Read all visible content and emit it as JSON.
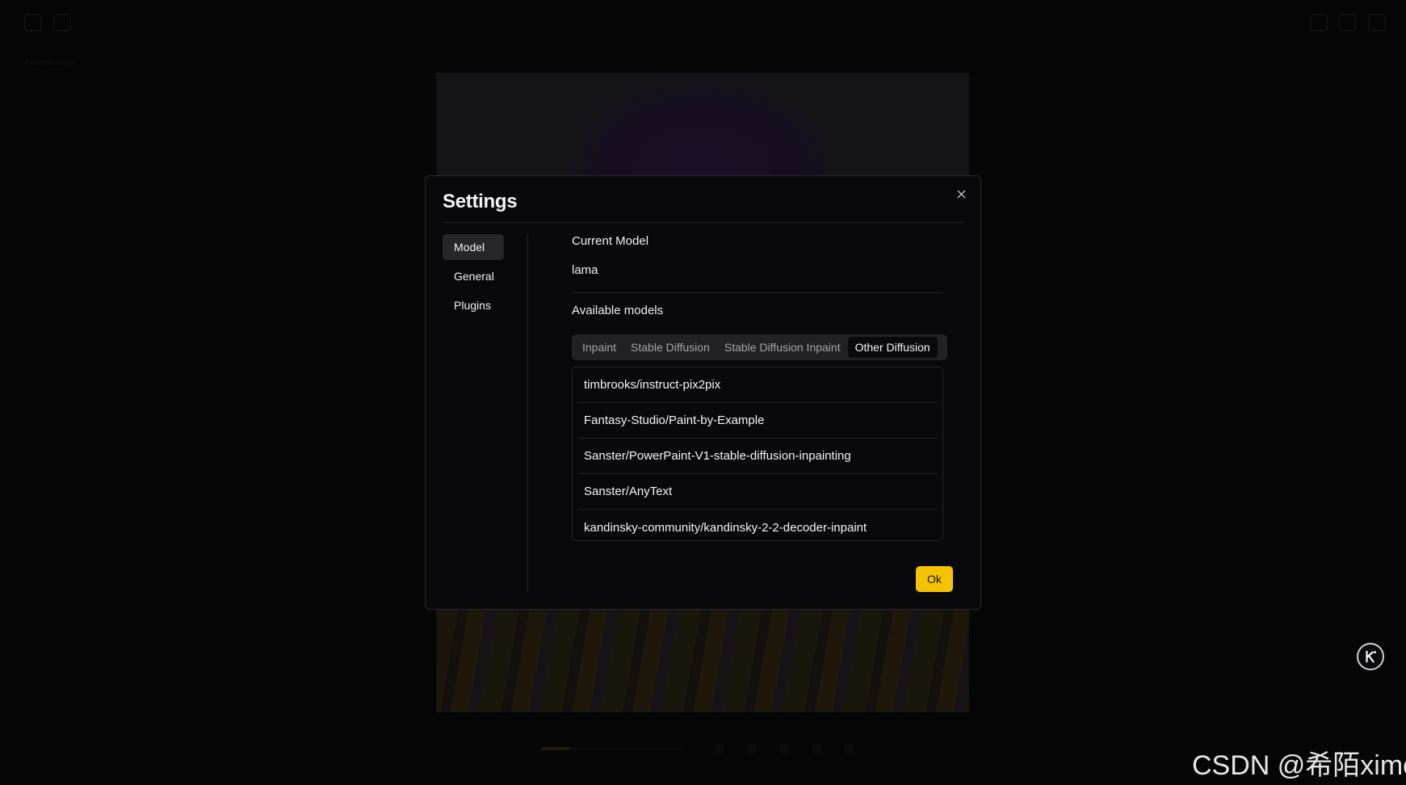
{
  "background": {
    "file_label": "hollow.bulb"
  },
  "dialog": {
    "title": "Settings",
    "close_icon": "close-icon",
    "nav": [
      {
        "label": "Model",
        "active": true
      },
      {
        "label": "General",
        "active": false
      },
      {
        "label": "Plugins",
        "active": false
      }
    ],
    "current_model_label": "Current Model",
    "current_model_value": "lama",
    "available_models_label": "Available models",
    "tabs": [
      {
        "label": "Inpaint",
        "active": false
      },
      {
        "label": "Stable Diffusion",
        "active": false
      },
      {
        "label": "Stable Diffusion Inpaint",
        "active": false
      },
      {
        "label": "Other Diffusion",
        "active": true
      }
    ],
    "models": [
      "timbrooks/instruct-pix2pix",
      "Fantasy-Studio/Paint-by-Example",
      "Sanster/PowerPaint-V1-stable-diffusion-inpainting",
      "Sanster/AnyText",
      "kandinsky-community/kandinsky-2-2-decoder-inpaint"
    ],
    "ok_label": "Ok"
  },
  "watermark": "CSDN @希陌ximo",
  "colors": {
    "accent": "#f5c400",
    "dialog_bg": "#09090b",
    "tab_active_bg": "#0a0a0c"
  }
}
